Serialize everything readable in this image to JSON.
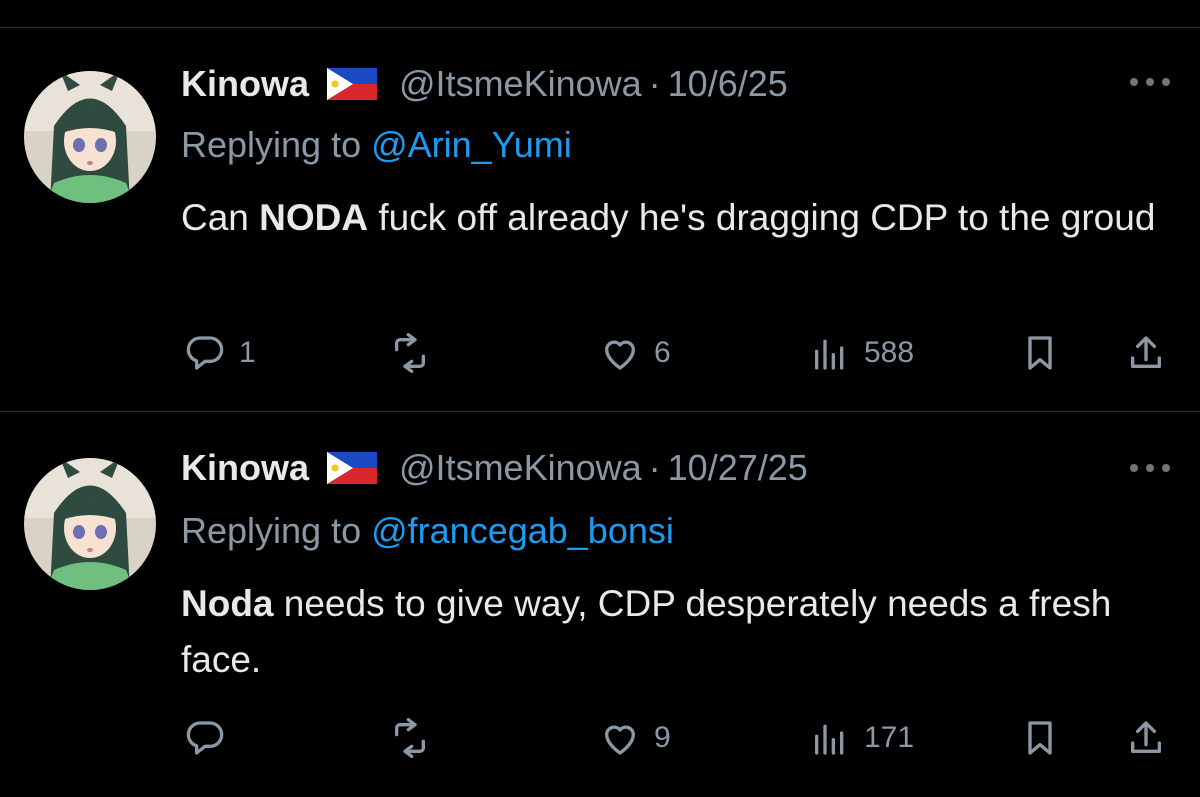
{
  "tweets": [
    {
      "name": "Kinowa",
      "handle": "@ItsmeKinowa",
      "separator": "·",
      "date": "10/6/25",
      "replying_prefix": "Replying to ",
      "replying_to": "@Arin_Yumi",
      "text_bold": "NODA",
      "text_before": "Can ",
      "text_after": " fuck off already he's dragging CDP to the groud",
      "replies": "1",
      "retweets": "",
      "likes": "6",
      "views": "588"
    },
    {
      "name": "Kinowa",
      "handle": "@ItsmeKinowa",
      "separator": "·",
      "date": "10/27/25",
      "replying_prefix": "Replying to ",
      "replying_to": "@francegab_bonsi",
      "text_bold": "Noda",
      "text_before": "",
      "text_after": " needs to give way, CDP desperately needs a fresh face.",
      "replies": "",
      "retweets": "",
      "likes": "9",
      "views": "171"
    }
  ],
  "icons": {
    "reply": "reply-icon",
    "retweet": "retweet-icon",
    "like": "heart-icon",
    "views": "views-icon",
    "bookmark": "bookmark-icon",
    "share": "share-icon",
    "more": "more-icon",
    "flag": "philippines-flag-icon"
  },
  "colors": {
    "background": "#000000",
    "text": "#e7e9ea",
    "muted": "#8b98a5",
    "link": "#1d9bf0",
    "divider": "#2f3336"
  }
}
